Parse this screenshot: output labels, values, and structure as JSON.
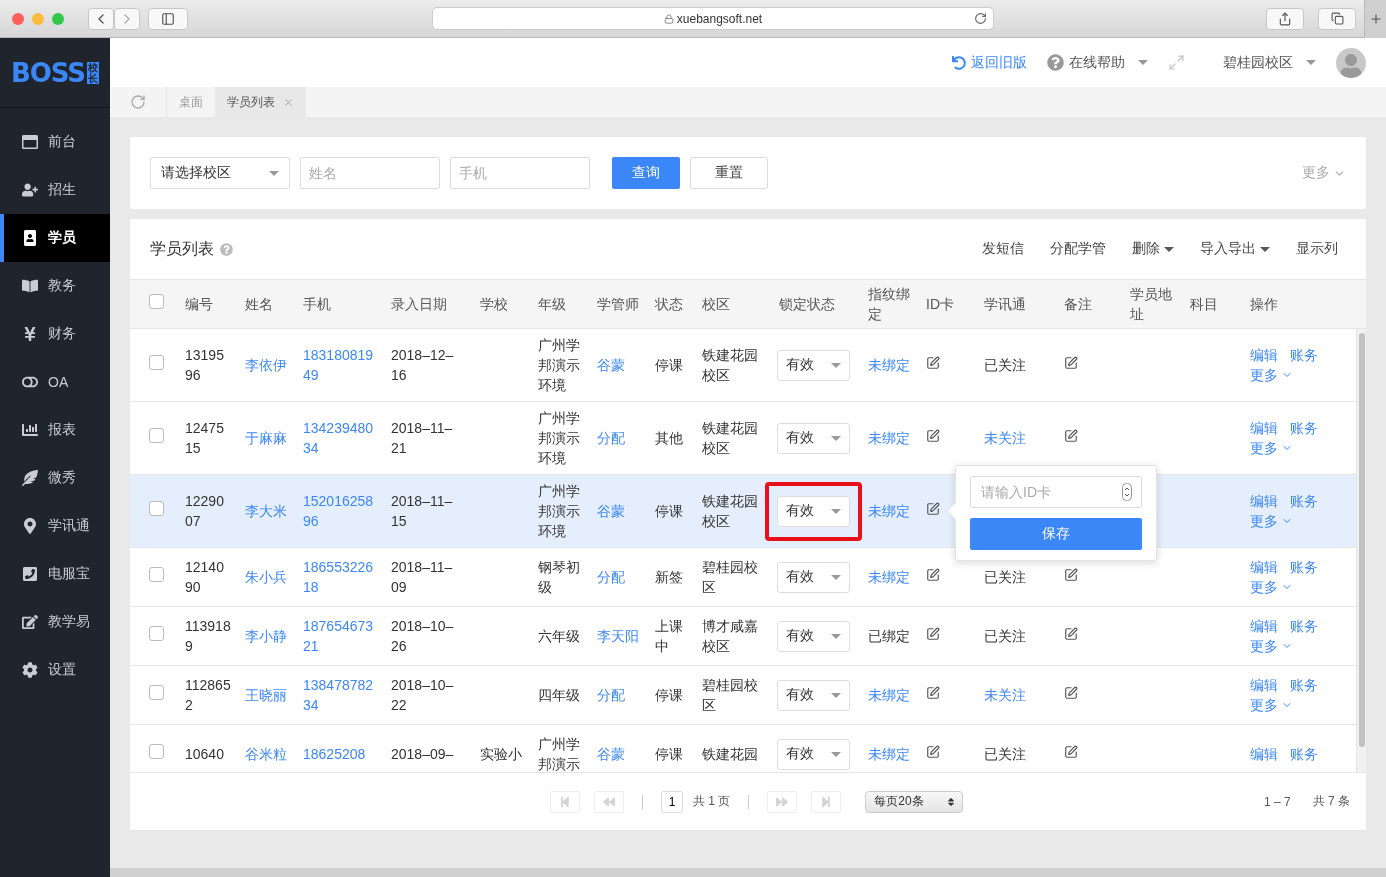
{
  "browser": {
    "url": "xuebangsoft.net"
  },
  "logo": {
    "text": "BOSS",
    "badge": "校长"
  },
  "sidebar": {
    "items": [
      {
        "label": "前台",
        "selected": false
      },
      {
        "label": "招生",
        "selected": false
      },
      {
        "label": "学员",
        "selected": true
      },
      {
        "label": "教务",
        "selected": false
      },
      {
        "label": "财务",
        "selected": false
      },
      {
        "label": "OA",
        "selected": false
      },
      {
        "label": "报表",
        "selected": false
      },
      {
        "label": "微秀",
        "selected": false
      },
      {
        "label": "学讯通",
        "selected": false
      },
      {
        "label": "电服宝",
        "selected": false
      },
      {
        "label": "教学易",
        "selected": false
      },
      {
        "label": "设置",
        "selected": false
      }
    ]
  },
  "header": {
    "back_link": "返回旧版",
    "help": "在线帮助",
    "campus": "碧桂园校区"
  },
  "page_tabs": [
    {
      "label": "桌面",
      "selected": false
    },
    {
      "label": "学员列表",
      "selected": true
    }
  ],
  "filters": {
    "campus_select": "请选择校区",
    "name_placeholder": "姓名",
    "phone_placeholder": "手机",
    "search_button": "查询",
    "reset_button": "重置",
    "more": "更多"
  },
  "list": {
    "title": "学员列表",
    "actions": [
      {
        "label": "发短信",
        "dropdown": false
      },
      {
        "label": "分配学管",
        "dropdown": false
      },
      {
        "label": "删除",
        "dropdown": true
      },
      {
        "label": "导入导出",
        "dropdown": true
      },
      {
        "label": "显示列",
        "dropdown": false
      }
    ]
  },
  "table": {
    "all_checked": false,
    "columns": [
      "编号",
      "姓名",
      "手机",
      "录入日期",
      "学校",
      "年级",
      "学管师",
      "状态",
      "校区",
      "锁定状态",
      "指纹绑定",
      "ID卡",
      "学讯通",
      "备注",
      "学员地址",
      "科目",
      "操作"
    ],
    "rows": [
      {
        "checked": false,
        "id": "1319596",
        "name": "李依伊",
        "phone": "18318081949",
        "date": "2018–12–16",
        "grade": "广州学邦演示环境",
        "teacher": "谷蒙",
        "status": "停课",
        "campus": "铁建花园校区",
        "lock": "有效",
        "lock_highlighted": false,
        "fingerprint": "未绑定",
        "fingerprint_bound": false,
        "wechat": "已关注",
        "followed": true,
        "selected": false,
        "id_popover_open": false,
        "ops": [
          "编辑",
          "账务",
          "更多"
        ]
      },
      {
        "checked": false,
        "id": "1247515",
        "name": "于麻麻",
        "phone": "13423948034",
        "date": "2018–11–21",
        "grade": "广州学邦演示环境",
        "teacher": "分配",
        "status": "其他",
        "campus": "铁建花园校区",
        "lock": "有效",
        "lock_highlighted": false,
        "fingerprint": "未绑定",
        "fingerprint_bound": false,
        "wechat": "未关注",
        "followed": false,
        "selected": false,
        "id_popover_open": false,
        "ops": [
          "编辑",
          "账务",
          "更多"
        ]
      },
      {
        "checked": false,
        "id": "1229007",
        "name": "李大米",
        "phone": "15201625896",
        "date": "2018–11–15",
        "grade": "广州学邦演示环境",
        "teacher": "谷蒙",
        "status": "停课",
        "campus": "铁建花园校区",
        "lock": "有效",
        "lock_highlighted": true,
        "fingerprint": "未绑定",
        "fingerprint_bound": false,
        "selected": true,
        "id_popover_open": true,
        "ops": [
          "编辑",
          "账务",
          "更多"
        ]
      },
      {
        "checked": false,
        "id": "1214090",
        "name": "朱小兵",
        "phone": "18655322618",
        "date": "2018–11–09",
        "grade": "钢琴初级",
        "teacher": "分配",
        "status": "新签",
        "campus": "碧桂园校区",
        "lock": "有效",
        "lock_highlighted": false,
        "fingerprint": "未绑定",
        "fingerprint_bound": false,
        "wechat": "已关注",
        "followed": true,
        "selected": false,
        "id_popover_open": false,
        "ops": [
          "编辑",
          "账务",
          "更多"
        ]
      },
      {
        "checked": false,
        "id": "1139189",
        "name": "李小静",
        "phone": "18765467321",
        "date": "2018–10–26",
        "grade": "六年级",
        "teacher": "李天阳",
        "status": "上课中",
        "campus": "博才咸嘉校区",
        "lock": "有效",
        "lock_highlighted": false,
        "fingerprint": "已绑定",
        "fingerprint_bound": true,
        "wechat": "已关注",
        "followed": true,
        "selected": false,
        "id_popover_open": false,
        "ops": [
          "编辑",
          "账务",
          "更多"
        ]
      },
      {
        "checked": false,
        "id": "1128652",
        "name": "王晓丽",
        "phone": "13847878234",
        "date": "2018–10–22",
        "grade": "四年级",
        "teacher": "分配",
        "status": "停课",
        "campus": "碧桂园校区",
        "lock": "有效",
        "lock_highlighted": false,
        "fingerprint": "未绑定",
        "fingerprint_bound": false,
        "wechat": "未关注",
        "followed": false,
        "selected": false,
        "id_popover_open": false,
        "ops": [
          "编辑",
          "账务",
          "更多"
        ]
      },
      {
        "checked": false,
        "id": "10640",
        "name": "谷米粒",
        "phone": "18625208",
        "date": "2018–09–",
        "school": "实验小",
        "grade": "广州学邦演示",
        "teacher": "谷蒙",
        "status": "停课",
        "campus": "铁建花园",
        "lock": "有效",
        "lock_highlighted": false,
        "fingerprint": "未绑定",
        "fingerprint_bound": false,
        "wechat": "已关注",
        "followed": true,
        "selected": false,
        "id_popover_open": false,
        "ops": [
          "编辑",
          "账务"
        ]
      }
    ]
  },
  "id_card_popover": {
    "placeholder": "请输入ID卡",
    "button": "保存"
  },
  "pagination": {
    "page": "1",
    "total_pages": "共 1 页",
    "page_size": "每页20条",
    "range": "1 – 7",
    "total": "共 7 条"
  }
}
